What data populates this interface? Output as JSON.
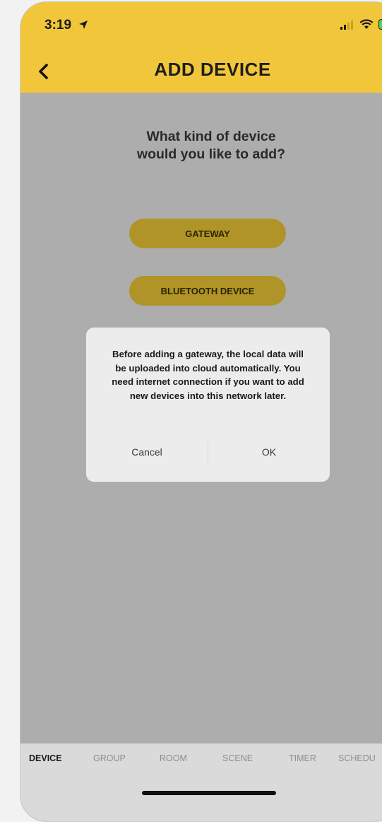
{
  "status_bar": {
    "time": "3:19"
  },
  "header": {
    "title": "ADD DEVICE",
    "background_color": "#f2c63a"
  },
  "main": {
    "question": "What kind of device\nwould you like to add?",
    "options": [
      {
        "label": "GATEWAY"
      },
      {
        "label": "BLUETOOTH DEVICE"
      }
    ]
  },
  "dialog": {
    "message": "Before adding a gateway, the local data will be uploaded into cloud automatically. You need internet connection if you want to add new devices into this network later.",
    "cancel_label": "Cancel",
    "ok_label": "OK"
  },
  "tabbar": {
    "tabs": [
      {
        "label": "DEVICE",
        "active": true
      },
      {
        "label": "GROUP",
        "active": false
      },
      {
        "label": "ROOM",
        "active": false
      },
      {
        "label": "SCENE",
        "active": false
      },
      {
        "label": "TIMER",
        "active": false
      },
      {
        "label": "SCHEDU",
        "active": false
      }
    ]
  },
  "icons": {
    "location": "location-arrow-icon",
    "signal": "cellular-signal-icon",
    "wifi": "wifi-icon",
    "battery": "battery-charging-icon",
    "back": "chevron-left-icon"
  }
}
